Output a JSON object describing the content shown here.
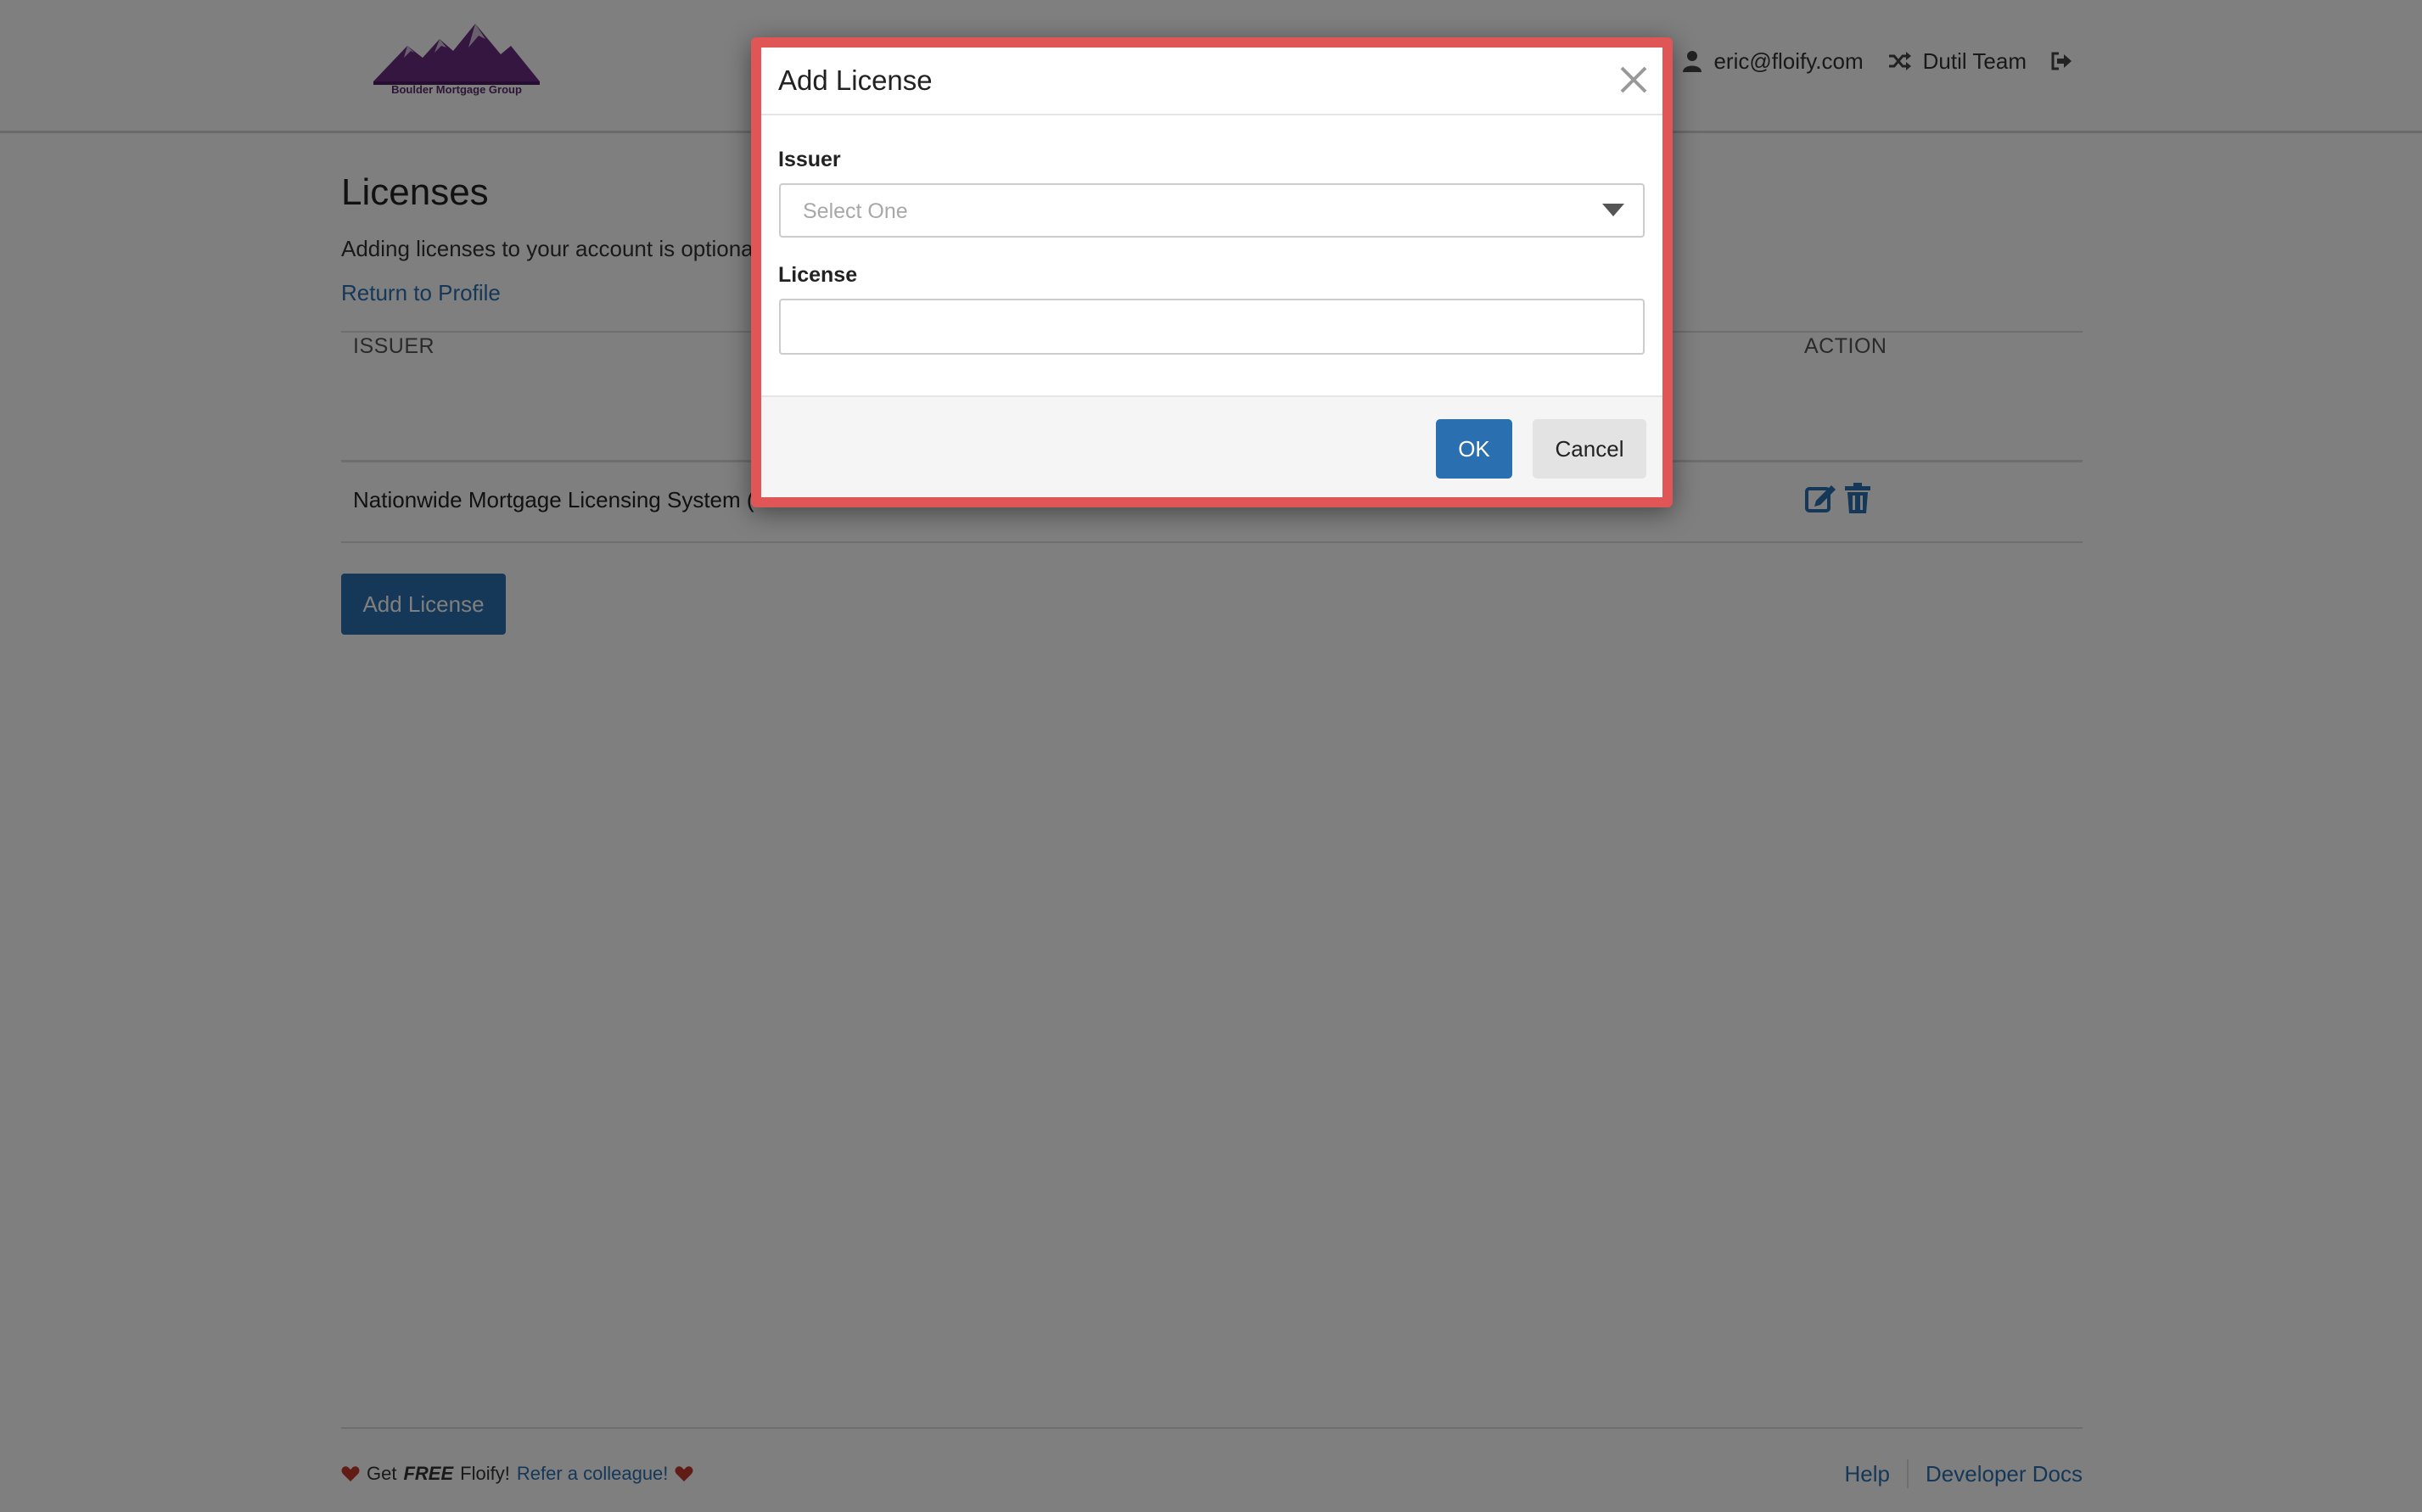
{
  "header": {
    "logo_text": "Boulder Mortgage Group",
    "user_email": "eric@floify.com",
    "team": "Dutil Team"
  },
  "page": {
    "title": "Licenses",
    "subtitle": "Adding licenses to your account is optional",
    "return_link": "Return to Profile",
    "add_button": "Add License"
  },
  "table": {
    "headers": [
      "ISSUER",
      "ACTION"
    ],
    "rows": [
      {
        "issuer": "Nationwide Mortgage Licensing System (N"
      }
    ]
  },
  "modal": {
    "title": "Add License",
    "issuer_label": "Issuer",
    "issuer_placeholder": "Select One",
    "license_label": "License",
    "license_value": "",
    "ok_label": "OK",
    "cancel_label": "Cancel"
  },
  "footer": {
    "get": "Get",
    "free": "FREE",
    "floify": "Floify!",
    "refer": "Refer a colleague!",
    "help": "Help",
    "docs": "Developer Docs"
  },
  "colors": {
    "accent": "#2a6fb0",
    "brand": "#5a2a6e",
    "modal_border": "#e05656",
    "heart": "#c0392b"
  }
}
